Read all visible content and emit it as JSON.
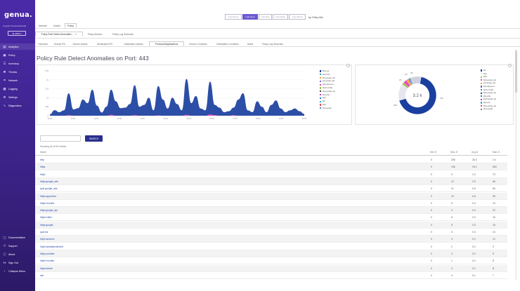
{
  "brand": {
    "logo": "genua.",
    "tagline": "Cognitix Threat Defender",
    "apply_label": "APPLY"
  },
  "nav": [
    {
      "id": "analytics",
      "label": "Analytics",
      "icon": "bar-chart-icon"
    },
    {
      "id": "policy",
      "label": "Policy",
      "icon": "document-icon"
    },
    {
      "id": "inventory",
      "label": "Inventory",
      "icon": "list-icon"
    },
    {
      "id": "threats",
      "label": "Threats",
      "icon": "x-icon"
    },
    {
      "id": "network",
      "label": "Network",
      "icon": "network-icon"
    },
    {
      "id": "logging",
      "label": "Logging",
      "icon": "log-icon"
    },
    {
      "id": "settings",
      "label": "Settings",
      "icon": "gear-icon"
    },
    {
      "id": "diagnostics",
      "label": "Diagnostics",
      "icon": "pulse-icon"
    }
  ],
  "nav_bottom": [
    {
      "id": "documentation",
      "label": "Documentation",
      "icon": "book-icon"
    },
    {
      "id": "support",
      "label": "Support",
      "icon": "support-icon"
    },
    {
      "id": "about",
      "label": "About",
      "icon": "info-icon"
    },
    {
      "id": "signout",
      "label": "Sign Out",
      "icon": "signout-icon"
    },
    {
      "id": "collapse",
      "label": "Collapse Menu",
      "icon": "chevron-left-icon"
    }
  ],
  "time": {
    "buttons": [
      "Last 5m(in)",
      "Last Hour",
      "Last Day",
      "Last Week",
      "Last Month"
    ],
    "selected": 1,
    "label": "by: Policy Hits"
  },
  "tabs1": [
    "Network",
    "Assets",
    "Policy"
  ],
  "tabs1_selected": 2,
  "tabs2": [
    "Policy Rule Detect Anomalies ...",
    "Policy Actions",
    "Policy Log Searches"
  ],
  "tabs2_selected": 0,
  "tabs3": [
    "Overview",
    "Source IPs",
    "Source Assets",
    "Destination IPs",
    "Destination Assets",
    "Protocols/Applications",
    "Source Countries",
    "Destination Countries",
    "Users",
    "Policy Log Searches"
  ],
  "tabs3_selected": 5,
  "page_title": "Policy Rule Detect Anomalies on Port: 443",
  "chart_data": [
    {
      "type": "area",
      "title": "",
      "y_ticks": [
        "2.5k",
        "2k",
        "1.5k",
        "1k",
        "500",
        "0"
      ],
      "ylim": [
        0,
        2500
      ],
      "x_ticks": [
        "09:00",
        "10:00",
        "11:00",
        "12:00",
        "13:00",
        "14:00",
        "15:00",
        "16:00",
        "17:00",
        "18:00",
        "19:00",
        "20:00"
      ],
      "legend_position": "right",
      "legend": [
        "https+ssl",
        "https+http",
        "https:google_ads",
        "quic:google_ads",
        "https:appnexus",
        "http2+mozilla",
        "https+google_api",
        "https+http",
        "http2",
        "http",
        "https",
        "https:google"
      ],
      "series": [
        {
          "name": "https+ssl",
          "color": "#1a3f9e",
          "values": [
            80,
            310,
            200,
            300,
            1250,
            350,
            420,
            900,
            700,
            1450,
            560,
            180,
            500,
            1450,
            800,
            420,
            450,
            650,
            1700,
            500,
            600,
            1000,
            300,
            1650,
            900,
            400,
            1000,
            650,
            300,
            2050,
            700,
            1100,
            400,
            300,
            1900,
            600,
            450,
            200,
            250,
            450,
            900,
            1250,
            300,
            200,
            800,
            500,
            200,
            600,
            850,
            400,
            200,
            300,
            400,
            250,
            100
          ]
        },
        {
          "name": "https:google_ads",
          "color": "#e04fb6",
          "values": [
            0,
            0,
            0,
            0,
            40,
            0,
            0,
            0,
            0,
            0,
            0,
            0,
            0,
            60,
            0,
            0,
            0,
            0,
            40,
            0,
            0,
            0,
            0,
            20,
            0,
            0,
            0,
            0,
            0,
            60,
            0,
            0,
            0,
            0,
            80,
            40,
            0,
            0,
            0,
            40,
            0,
            0,
            0,
            0,
            0,
            0,
            0,
            0,
            0,
            0,
            0,
            0,
            0,
            0,
            0
          ]
        }
      ]
    },
    {
      "type": "pie",
      "center_label": "3.2 k",
      "slices": [
        {
          "name": "http",
          "value": 2160,
          "color": "#1a3f9e"
        },
        {
          "name": "https",
          "value": 460,
          "color": "#e6e6ef"
        },
        {
          "name": "http2",
          "value": 60,
          "color": "#9ac040"
        },
        {
          "name": "https:google_ads",
          "value": 100,
          "color": "#e04fb6"
        },
        {
          "name": "quic:google_ads",
          "value": 60,
          "color": "#f0a030"
        },
        {
          "name": "https:appnexus",
          "value": 40,
          "color": "#6d5bd0"
        },
        {
          "name": "http2+mozilla",
          "value": 30,
          "color": "#2aa7a0"
        },
        {
          "name": "other",
          "value": 290,
          "color": "#cfcfe0"
        }
      ],
      "outer_labels": [
        "3.1k",
        "46%",
        "2%",
        "1%",
        "3%"
      ],
      "legend": [
        "http",
        "https",
        "http2",
        "https:google_ads",
        "quic:google_ads",
        "https:appnexus",
        "http2+mozilla",
        "https+google_api",
        "https+http",
        "http2+google_api",
        "https+ssl",
        "https+google_api",
        "https+google"
      ]
    }
  ],
  "table": {
    "search_label": "SEARCH",
    "showing": "Showing 60 of 60 entries",
    "headers": [
      "Name",
      "Min",
      "Max",
      "Avg",
      "Total"
    ],
    "rows": [
      {
        "name": "http",
        "min": "0",
        "max": "206",
        "avg": "26.3",
        "total": "2 k"
      },
      {
        "name": "https",
        "min": "0",
        "max": "106",
        "avg": "16.1",
        "total": "663"
      },
      {
        "name": "http2",
        "min": "0",
        "max": "9",
        "avg": "1.2",
        "total": "70"
      },
      {
        "name": "https:google_ads",
        "min": "0",
        "max": "12",
        "avg": "2.9",
        "total": "66"
      },
      {
        "name": "quic:google_ads",
        "min": "0",
        "max": "11",
        "avg": "0.6",
        "total": "66"
      },
      {
        "name": "https:appnexus",
        "min": "0",
        "max": "10",
        "avg": "0.6",
        "total": "35"
      },
      {
        "name": "https+mozilla",
        "min": "0",
        "max": "6",
        "avg": "0.4",
        "total": "19"
      },
      {
        "name": "https:google_api",
        "min": "0",
        "max": "3",
        "avg": "0.4",
        "total": "22"
      },
      {
        "name": "https+ciltex",
        "min": "0",
        "max": "8",
        "avg": "0.3",
        "total": "16"
      },
      {
        "name": "https:google",
        "min": "0",
        "max": "5",
        "avg": "0.3",
        "total": "16"
      },
      {
        "name": "quic:ssl",
        "min": "0",
        "max": "3",
        "avg": "0.3",
        "total": "14"
      },
      {
        "name": "http2:amazon",
        "min": "0",
        "max": "3",
        "avg": "0.2",
        "total": "12"
      },
      {
        "name": "http2:adsafeprotected",
        "min": "0",
        "max": "2",
        "avg": "0.2",
        "total": "9"
      },
      {
        "name": "https:youtube",
        "min": "0",
        "max": "3",
        "avg": "0.2",
        "total": "9"
      },
      {
        "name": "http2+mozilla",
        "min": "0",
        "max": "1",
        "avg": "0.2",
        "total": "8"
      },
      {
        "name": "https:adobe",
        "min": "0",
        "max": "3",
        "avg": "0.2",
        "total": "8"
      },
      {
        "name": "ssh",
        "min": "0",
        "max": "4",
        "avg": "0.1",
        "total": "7"
      }
    ]
  }
}
